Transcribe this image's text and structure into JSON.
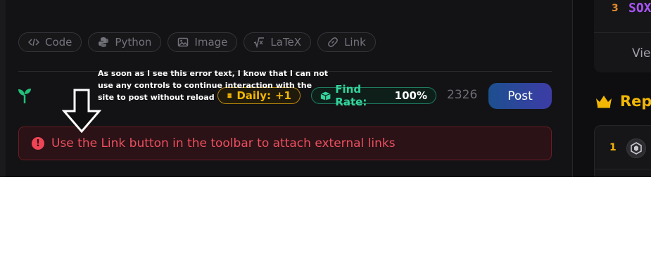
{
  "toolbar": {
    "code_label": "Code",
    "python_label": "Python",
    "image_label": "Image",
    "latex_label": "LaTeX",
    "link_label": "Link"
  },
  "status": {
    "daily_label": "Daily:",
    "daily_value": "+1",
    "find_rate_label": "Find Rate:",
    "find_rate_value": "100%",
    "count": "2326",
    "post_label": "Post"
  },
  "error": {
    "icon": "!",
    "message": "Use the Link button in the toolbar to attach external links"
  },
  "annotation": {
    "text": "As soon as I see this error text, I know that I can not use any controls to continue interaction with the site to post without reload"
  },
  "sidebar": {
    "top_rank": "3",
    "top_name": "SOX",
    "view_label": "Vie",
    "section_title": "Rep",
    "list_rank": "1"
  },
  "colors": {
    "daily": "#f2b705",
    "find_rate": "#34d39b",
    "error": "#ee4f5f",
    "post_gradient_start": "#1d4f8f",
    "post_gradient_end": "#3d3ca6"
  },
  "icons": [
    "code-icon",
    "python-icon",
    "image-icon",
    "latex-icon",
    "link-icon",
    "sprout-icon",
    "coins-icon",
    "box-icon",
    "error-icon",
    "down-arrow-icon",
    "crown-icon",
    "avatar-icon"
  ]
}
